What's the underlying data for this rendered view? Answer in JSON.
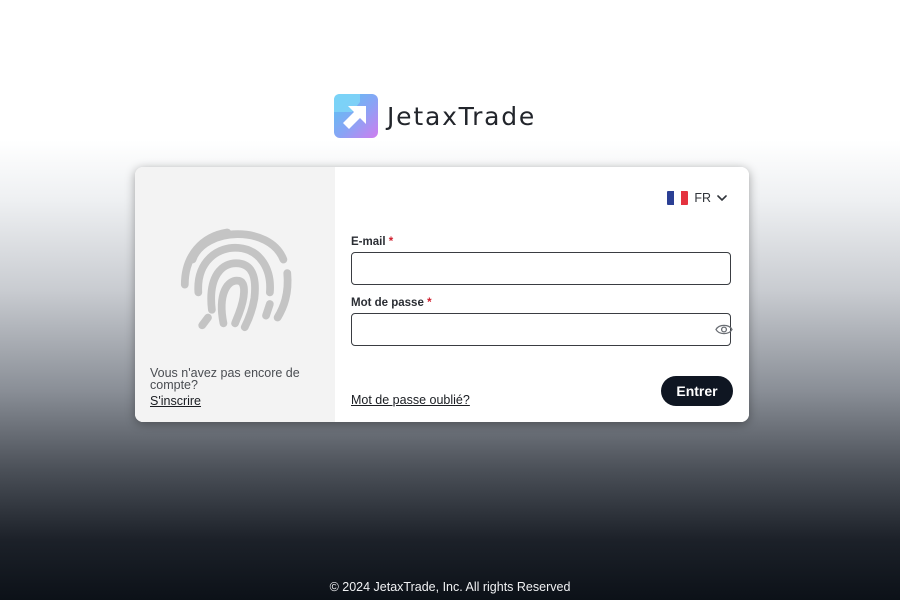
{
  "brand": {
    "name": "JetaxTrade",
    "logo_icon": "arrow-up-right-icon",
    "gradient": [
      "#5ec8f2",
      "#c77ef0"
    ]
  },
  "language": {
    "code": "FR",
    "flag_icon": "france-flag-icon",
    "flag_colors": [
      "#2b3f94",
      "#ffffff",
      "#e4323f"
    ]
  },
  "left_panel": {
    "illustration": "fingerprint-icon",
    "signup_prompt": "Vous n'avez pas encore de compte?",
    "signup_link": "S'inscrire"
  },
  "form": {
    "email": {
      "label": "E-mail",
      "required_mark": "*",
      "value": "",
      "placeholder": ""
    },
    "password": {
      "label": "Mot de passe",
      "required_mark": "*",
      "value": "",
      "placeholder": "",
      "toggle_icon": "eye-icon"
    },
    "forgot_link": "Mot de passe oublié?",
    "submit_label": "Entrer"
  },
  "colors": {
    "primary_button": "#0f1622",
    "required": "#d0202f"
  },
  "footer": {
    "copyright": "© 2024 JetaxTrade, Inc. All rights Reserved"
  }
}
